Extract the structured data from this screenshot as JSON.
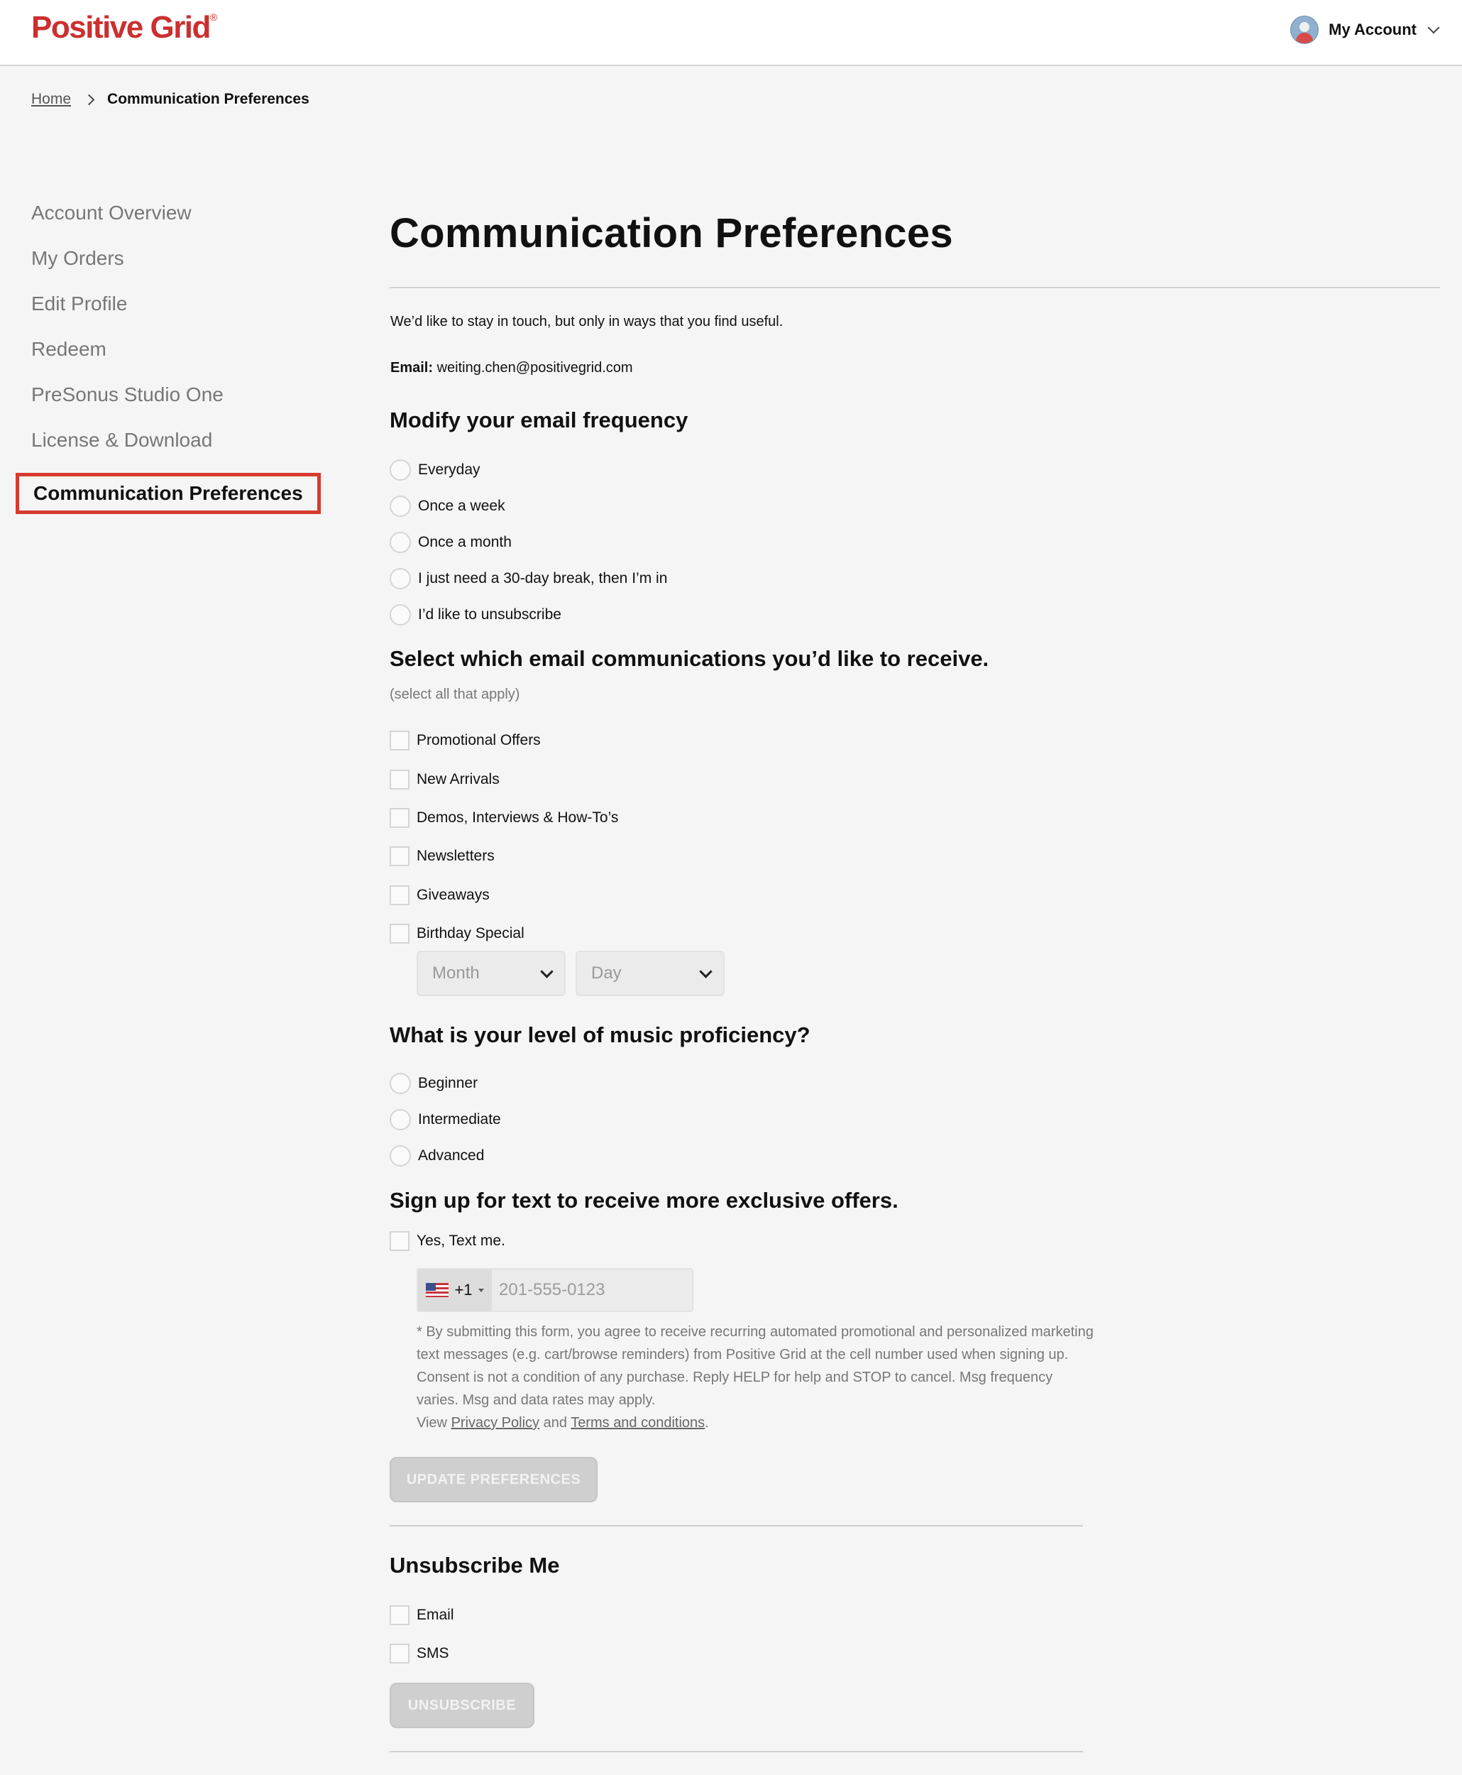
{
  "header": {
    "logo": "Positive Grid",
    "logo_mark": "®",
    "account_label": "My Account"
  },
  "breadcrumb": {
    "home": "Home",
    "current": "Communication Preferences"
  },
  "sidebar": {
    "items": [
      {
        "label": "Account Overview"
      },
      {
        "label": "My Orders"
      },
      {
        "label": "Edit Profile"
      },
      {
        "label": "Redeem"
      },
      {
        "label": "PreSonus Studio One"
      },
      {
        "label": "License & Download"
      },
      {
        "label": "Communication Preferences"
      }
    ]
  },
  "main": {
    "title": "Communication Preferences",
    "intro": "We’d like to stay in touch, but only in ways that you find useful.",
    "email_label": "Email:",
    "email_value": "weiting.chen@positivegrid.com",
    "frequency": {
      "heading": "Modify your email frequency",
      "options": [
        "Everyday",
        "Once a week",
        "Once a month",
        "I just need a 30-day break, then I’m in",
        "I’d like to unsubscribe"
      ]
    },
    "communications": {
      "heading": "Select which email communications you’d like to receive.",
      "note": "(select all that apply)",
      "options": [
        "Promotional Offers",
        "New Arrivals",
        "Demos, Interviews & How-To’s",
        "Newsletters",
        "Giveaways",
        "Birthday Special"
      ],
      "month_placeholder": "Month",
      "day_placeholder": "Day"
    },
    "proficiency": {
      "heading": "What is your level of music proficiency?",
      "options": [
        "Beginner",
        "Intermediate",
        "Advanced"
      ]
    },
    "sms": {
      "heading": "Sign up for text to receive more exclusive offers.",
      "checkbox_label": "Yes, Text me.",
      "country_code": "+1",
      "phone_placeholder": "201-555-0123",
      "disclaimer": "* By submitting this form, you agree to receive recurring automated promotional and personalized marketing text messages (e.g. cart/browse reminders) from Positive Grid at the cell number used when signing up. Consent is not a condition of any purchase. Reply HELP for help and STOP to cancel. Msg frequency varies. Msg and data rates may apply.",
      "view_text": "View",
      "privacy_link": "Privacy Policy",
      "and_text": "and",
      "terms_link": "Terms and conditions",
      "period": "."
    },
    "update_button": "UPDATE PREFERENCES",
    "unsubscribe": {
      "heading": "Unsubscribe Me",
      "options": [
        "Email",
        "SMS"
      ],
      "button": "UNSUBSCRIBE"
    }
  },
  "colors": {
    "brand": "#cc2f2f",
    "active_outline": "#d83a30",
    "disabled_button": "#cfcfcf"
  }
}
